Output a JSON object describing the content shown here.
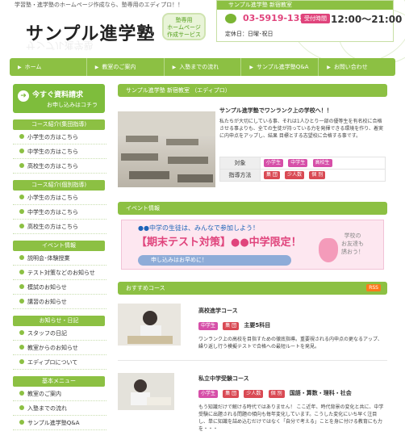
{
  "header": {
    "tagline": "学習塾・進学塾のホームページ作成なら、塾専用のエディプロ！！",
    "logo_text": "サンプル進学塾",
    "speech_badge": "塾専用\nホームページ\n作成サービス",
    "contact": {
      "top_label": "サンプル進学塾 新宿教室",
      "phone": "03-5919-1356",
      "reception_label": "受付時間",
      "hours": "12:00～21:00",
      "holiday": "定休日：日曜･祝日"
    }
  },
  "nav": {
    "items": [
      "ホーム",
      "教室のご案内",
      "入塾までの流れ",
      "サンプル進学塾Q&A",
      "お問い合わせ"
    ]
  },
  "sidebar": {
    "cta_title": "今すぐ資料請求",
    "cta_sub": "お申し込みはコチラ",
    "sections": [
      {
        "title": "コース紹介(集団指導)",
        "items": [
          "小学生の方はこちら",
          "中学生の方はこちら",
          "高校生の方はこちら"
        ]
      },
      {
        "title": "コース紹介(個別指導)",
        "items": [
          "小学生の方はこちら",
          "中学生の方はこちら",
          "高校生の方はこちら"
        ]
      },
      {
        "title": "イベント情報",
        "items": [
          "説明会･体験授業",
          "テスト対策などのお知らせ",
          "模試のお知らせ",
          "講習のお知らせ"
        ]
      },
      {
        "title": "お知らせ・日記",
        "items": [
          "スタッフの日記",
          "教室からのお知らせ",
          "エディプロについて"
        ]
      },
      {
        "title": "基本メニュー",
        "items": [
          "教室のご案内",
          "入塾までの流れ",
          "サンプル進学塾Q&A"
        ]
      }
    ]
  },
  "main": {
    "intro_head": "サンプル進学塾 新宿教室 （エディプロ）",
    "intro_title": "サンプル進学塾でワンランク上の学校へ！！",
    "intro_text": "私たちが大切にしている事、それは1人ひとり一部の優等生を有名校に合格させる事よりも、全ての生徒が持っている力を発揮できる環境を作り、着実に内申点をアップし、結果 目標とする志望校に合格する事です。",
    "table": {
      "target_label": "対象",
      "target_tags": [
        "小学生",
        "中学生",
        "高校生"
      ],
      "method_label": "指導方法",
      "method_tags": [
        "集 団",
        "少人数",
        "個 別"
      ]
    },
    "event_head": "イベント情報",
    "event": {
      "top": "●●中学の生徒は、みんなで参加しよう！",
      "main": "【期末テスト対策】●●中学限定！",
      "button": "申し込みはお早めに！",
      "side": "学校の\nお友達も\n誘おう！"
    },
    "recommend_head": "おすすめコース",
    "rss": "RSS",
    "courses": [
      {
        "title": "高校進学コース",
        "tags": [
          "中学生",
          "集 団"
        ],
        "extra": "主要5科目",
        "text": "ワンランク上の高校を目指すための徹底指導。重要視される内申点の更なるアップ、繰り返し行う模擬テストで合格への最短ルートを発見。"
      },
      {
        "title": "私立中学受験コース",
        "tags": [
          "小学生",
          "集 団",
          "少人数",
          "個 別"
        ],
        "extra": "国語・算数・理科・社会",
        "text": "もう知識だけで解ける時代ではありません！ ここ近年、時代背景の変化と共に、中学受験に出題される問題の傾向も毎年変化しています。こうした変化にいち早く注目し、単に知識を詰め込むだけではなく「自分で考える」ことを身に付ける教育にも力を・・・"
      }
    ]
  }
}
